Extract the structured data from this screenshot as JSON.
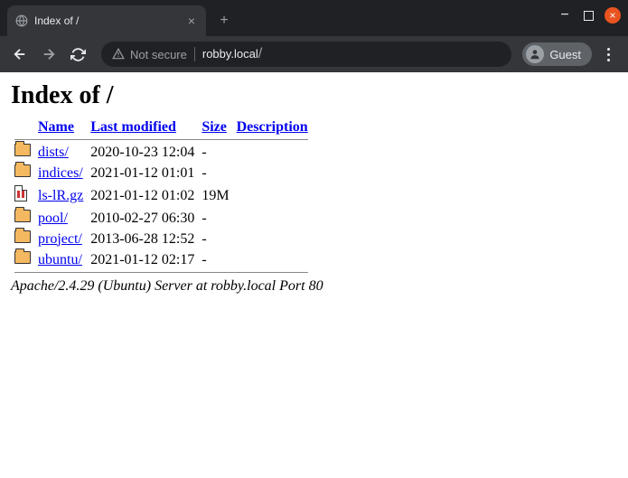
{
  "browser": {
    "tab_title": "Index of /",
    "not_secure_label": "Not secure",
    "url_host": "robby.local",
    "url_path": "/",
    "guest_label": "Guest"
  },
  "page": {
    "heading": "Index of /",
    "columns": {
      "name": "Name",
      "last_modified": "Last modified",
      "size": "Size",
      "description": "Description"
    },
    "entries": [
      {
        "icon": "folder",
        "name": "dists/",
        "modified": "2020-10-23 12:04",
        "size": "-"
      },
      {
        "icon": "folder",
        "name": "indices/",
        "modified": "2021-01-12 01:01",
        "size": "-"
      },
      {
        "icon": "file-gz",
        "name": "ls-lR.gz",
        "modified": "2021-01-12 01:02",
        "size": "19M"
      },
      {
        "icon": "folder",
        "name": "pool/",
        "modified": "2010-02-27 06:30",
        "size": "-"
      },
      {
        "icon": "folder",
        "name": "project/",
        "modified": "2013-06-28 12:52",
        "size": "-"
      },
      {
        "icon": "folder",
        "name": "ubuntu/",
        "modified": "2021-01-12 02:17",
        "size": "-"
      }
    ],
    "server_info": "Apache/2.4.29 (Ubuntu) Server at robby.local Port 80"
  }
}
